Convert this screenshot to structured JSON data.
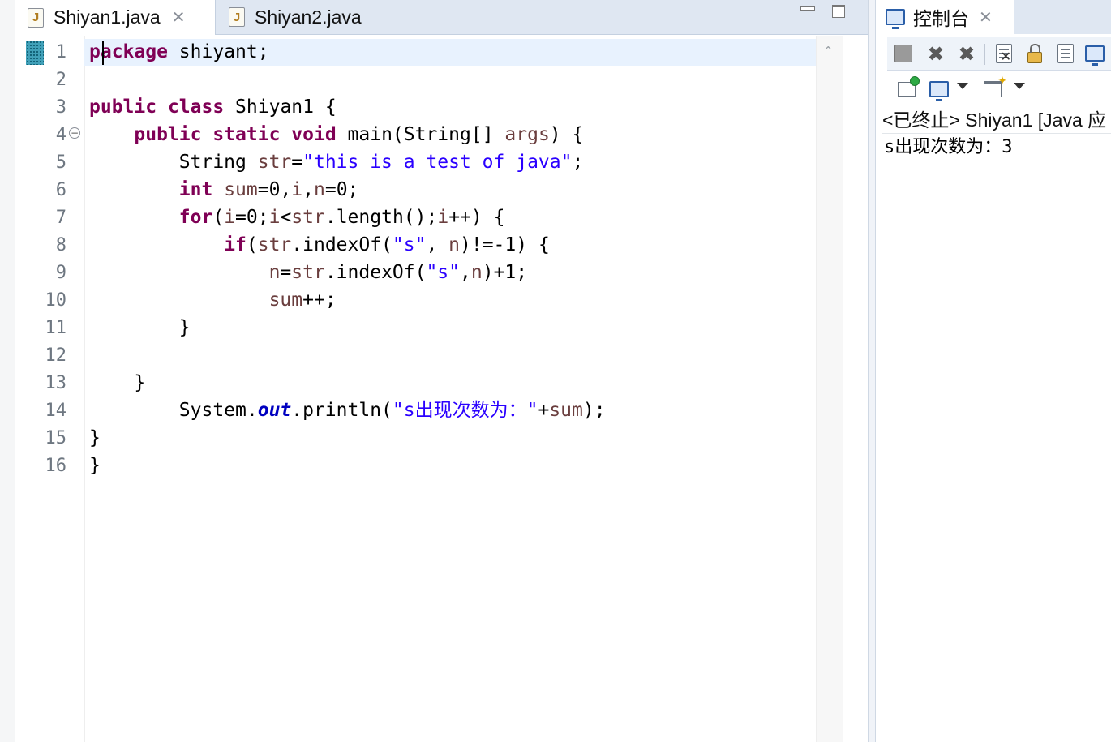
{
  "editor": {
    "tabs": [
      {
        "label": "Shiyan1.java",
        "icon": "java-file-icon",
        "active": true
      },
      {
        "label": "Shiyan2.java",
        "icon": "java-file-icon",
        "active": false
      }
    ],
    "line_numbers": [
      "1",
      "2",
      "3",
      "4",
      "5",
      "6",
      "7",
      "8",
      "9",
      "10",
      "11",
      "12",
      "13",
      "14",
      "15",
      "16"
    ],
    "code": [
      [
        {
          "t": "package",
          "c": "kw"
        },
        {
          "t": " shiyant;"
        }
      ],
      [],
      [
        {
          "t": "public",
          "c": "kw"
        },
        {
          "t": " "
        },
        {
          "t": "class",
          "c": "kw"
        },
        {
          "t": " Shiyan1 {"
        }
      ],
      [
        {
          "t": "    "
        },
        {
          "t": "public",
          "c": "kw"
        },
        {
          "t": " "
        },
        {
          "t": "static",
          "c": "kw"
        },
        {
          "t": " "
        },
        {
          "t": "void",
          "c": "kw"
        },
        {
          "t": " main(String[] "
        },
        {
          "t": "args",
          "c": "var"
        },
        {
          "t": ") {"
        }
      ],
      [
        {
          "t": "        String "
        },
        {
          "t": "str",
          "c": "var"
        },
        {
          "t": "="
        },
        {
          "t": "\"this is a test of java\"",
          "c": "str"
        },
        {
          "t": ";"
        }
      ],
      [
        {
          "t": "        "
        },
        {
          "t": "int",
          "c": "kw"
        },
        {
          "t": " "
        },
        {
          "t": "sum",
          "c": "var"
        },
        {
          "t": "=0,"
        },
        {
          "t": "i",
          "c": "var"
        },
        {
          "t": ","
        },
        {
          "t": "n",
          "c": "var"
        },
        {
          "t": "=0;"
        }
      ],
      [
        {
          "t": "        "
        },
        {
          "t": "for",
          "c": "kw"
        },
        {
          "t": "("
        },
        {
          "t": "i",
          "c": "var"
        },
        {
          "t": "=0;"
        },
        {
          "t": "i",
          "c": "var"
        },
        {
          "t": "<"
        },
        {
          "t": "str",
          "c": "var"
        },
        {
          "t": ".length();"
        },
        {
          "t": "i",
          "c": "var"
        },
        {
          "t": "++) {"
        }
      ],
      [
        {
          "t": "            "
        },
        {
          "t": "if",
          "c": "kw"
        },
        {
          "t": "("
        },
        {
          "t": "str",
          "c": "var"
        },
        {
          "t": ".indexOf("
        },
        {
          "t": "\"s\"",
          "c": "str"
        },
        {
          "t": ", "
        },
        {
          "t": "n",
          "c": "var"
        },
        {
          "t": ")!=-1) {"
        }
      ],
      [
        {
          "t": "                "
        },
        {
          "t": "n",
          "c": "var"
        },
        {
          "t": "="
        },
        {
          "t": "str",
          "c": "var"
        },
        {
          "t": ".indexOf("
        },
        {
          "t": "\"s\"",
          "c": "str"
        },
        {
          "t": ","
        },
        {
          "t": "n",
          "c": "var"
        },
        {
          "t": ")+1;"
        }
      ],
      [
        {
          "t": "                "
        },
        {
          "t": "sum",
          "c": "var"
        },
        {
          "t": "++;"
        }
      ],
      [
        {
          "t": "        }"
        }
      ],
      [],
      [
        {
          "t": "    }"
        }
      ],
      [
        {
          "t": "        System."
        },
        {
          "t": "out",
          "c": "fld"
        },
        {
          "t": ".println("
        },
        {
          "t": "\"s出现次数为：\"",
          "c": "str"
        },
        {
          "t": "+"
        },
        {
          "t": "sum",
          "c": "var"
        },
        {
          "t": ");"
        }
      ],
      [
        {
          "t": "}"
        }
      ],
      [
        {
          "t": "}"
        }
      ]
    ],
    "current_line": 1,
    "colors": {
      "keyword": "#7f0055",
      "string": "#2a00ff",
      "variable": "#6a3e3e",
      "field": "#0000c0",
      "current_line": "#e8f2fe"
    }
  },
  "console": {
    "tab_label": "控制台",
    "tab_icon": "console-monitor-icon",
    "header": "<已终止> Shiyan1 [Java 应",
    "output_lines": [
      "s出现次数为：3"
    ],
    "toolbar_row1": [
      "stop-icon",
      "remove-launch-icon",
      "remove-all-terminated-icon",
      "clear-console-icon",
      "scroll-lock-icon",
      "word-wrap-icon",
      "show-on-output-icon",
      "display-console-icon"
    ],
    "toolbar_row2": [
      "pin-console-icon",
      "display-selected-console-icon",
      "open-console-icon"
    ]
  }
}
